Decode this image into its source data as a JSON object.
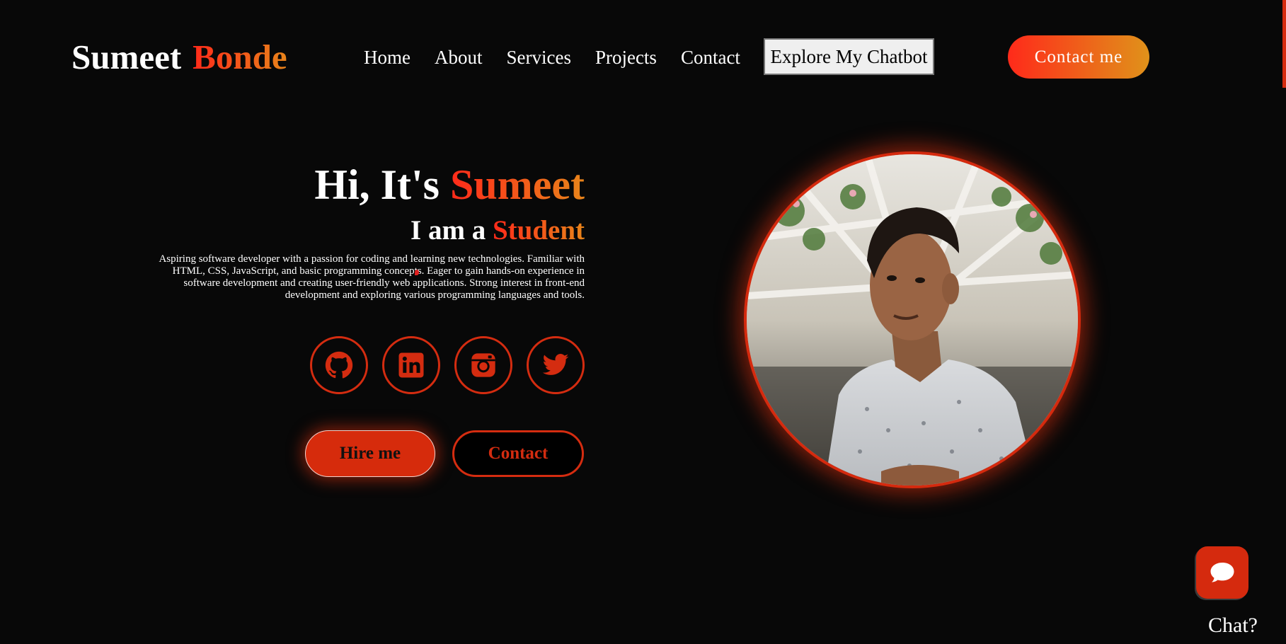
{
  "brand": {
    "first_name": "Sumeet",
    "last_name": "Bonde"
  },
  "nav": {
    "items": [
      {
        "label": "Home"
      },
      {
        "label": "About"
      },
      {
        "label": "Services"
      },
      {
        "label": "Projects"
      },
      {
        "label": "Contact"
      }
    ],
    "chatbot_button": "Explore My Chatbot",
    "contact_button": "Contact me"
  },
  "hero": {
    "greeting": "Hi, It's ",
    "name": "Sumeet",
    "role_prefix": "I am a ",
    "role": "Student",
    "description": "Aspiring software developer with a passion for coding and learning new technologies. Familiar with HTML, CSS, JavaScript, and basic programming concepts. Eager to gain hands-on experience in software development and creating user-friendly web applications. Strong interest in front-end development and exploring various programming languages and tools.",
    "socials": [
      "github-icon",
      "linkedin-icon",
      "instagram-icon",
      "twitter-icon"
    ],
    "hire_button": "Hire me",
    "contact_button": "Contact"
  },
  "chat": {
    "label": "Chat?",
    "icon": "chat-bubble-icon"
  },
  "colors": {
    "background": "#080808",
    "accent": "#d42c10",
    "gradient_start": "#ff2a1a",
    "gradient_end": "#e8841a"
  }
}
